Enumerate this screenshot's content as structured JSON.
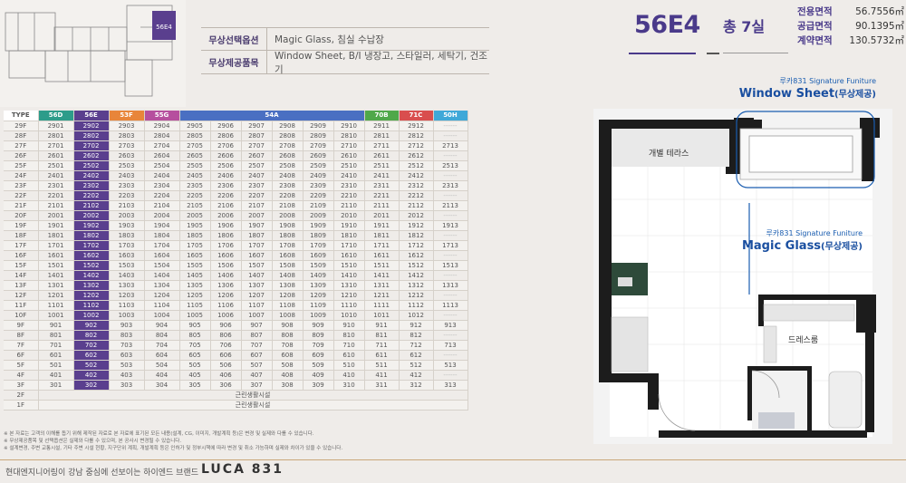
{
  "keyplan": {
    "highlight_label": "56E4"
  },
  "options": [
    {
      "label": "무상선택옵션",
      "value": "Magic Glass, 침실 수납장"
    },
    {
      "label": "무상제공품목",
      "value": "Window Sheet, B/I 냉장고, 스타일러, 세탁기, 건조기"
    }
  ],
  "unit": {
    "name": "56E4",
    "rooms": "총 7실",
    "areas": [
      {
        "label": "전용면적",
        "value": "56.7556㎡"
      },
      {
        "label": "공급면적",
        "value": "90.1395㎡"
      },
      {
        "label": "계약면적",
        "value": "130.5732㎡"
      }
    ]
  },
  "table": {
    "type_label": "TYPE",
    "headers": [
      {
        "label": "56D",
        "color": "#2d9c8a",
        "span": 1
      },
      {
        "label": "56E",
        "color": "#5a3f8e",
        "span": 1
      },
      {
        "label": "53F",
        "color": "#e8853a",
        "span": 1
      },
      {
        "label": "55G",
        "color": "#b64f9e",
        "span": 1
      },
      {
        "label": "54A",
        "color": "#4a6fc2",
        "span": 6
      },
      {
        "label": "70B",
        "color": "#4fa84a",
        "span": 1
      },
      {
        "label": "71C",
        "color": "#d94e4e",
        "span": 1
      },
      {
        "label": "50H",
        "color": "#3fa8d8",
        "span": 1
      }
    ],
    "highlight_col": 1,
    "rows": [
      {
        "floor": "29F",
        "cells": [
          "2901",
          "2902",
          "2903",
          "2904",
          "2905",
          "2906",
          "2907",
          "2908",
          "2909",
          "2910",
          "2911",
          "2912",
          ""
        ]
      },
      {
        "floor": "28F",
        "cells": [
          "2801",
          "2802",
          "2803",
          "2804",
          "2805",
          "2806",
          "2807",
          "2808",
          "2809",
          "2810",
          "2811",
          "2812",
          ""
        ]
      },
      {
        "floor": "27F",
        "cells": [
          "2701",
          "2702",
          "2703",
          "2704",
          "2705",
          "2706",
          "2707",
          "2708",
          "2709",
          "2710",
          "2711",
          "2712",
          "2713"
        ]
      },
      {
        "floor": "26F",
        "cells": [
          "2601",
          "2602",
          "2603",
          "2604",
          "2605",
          "2606",
          "2607",
          "2608",
          "2609",
          "2610",
          "2611",
          "2612",
          ""
        ]
      },
      {
        "floor": "25F",
        "cells": [
          "2501",
          "2502",
          "2503",
          "2504",
          "2505",
          "2506",
          "2507",
          "2508",
          "2509",
          "2510",
          "2511",
          "2512",
          "2513"
        ]
      },
      {
        "floor": "24F",
        "cells": [
          "2401",
          "2402",
          "2403",
          "2404",
          "2405",
          "2406",
          "2407",
          "2408",
          "2409",
          "2410",
          "2411",
          "2412",
          ""
        ]
      },
      {
        "floor": "23F",
        "cells": [
          "2301",
          "2302",
          "2303",
          "2304",
          "2305",
          "2306",
          "2307",
          "2308",
          "2309",
          "2310",
          "2311",
          "2312",
          "2313"
        ]
      },
      {
        "floor": "22F",
        "cells": [
          "2201",
          "2202",
          "2203",
          "2204",
          "2205",
          "2206",
          "2207",
          "2208",
          "2209",
          "2210",
          "2211",
          "2212",
          ""
        ]
      },
      {
        "floor": "21F",
        "cells": [
          "2101",
          "2102",
          "2103",
          "2104",
          "2105",
          "2106",
          "2107",
          "2108",
          "2109",
          "2110",
          "2111",
          "2112",
          "2113"
        ]
      },
      {
        "floor": "20F",
        "cells": [
          "2001",
          "2002",
          "2003",
          "2004",
          "2005",
          "2006",
          "2007",
          "2008",
          "2009",
          "2010",
          "2011",
          "2012",
          ""
        ]
      },
      {
        "floor": "19F",
        "cells": [
          "1901",
          "1902",
          "1903",
          "1904",
          "1905",
          "1906",
          "1907",
          "1908",
          "1909",
          "1910",
          "1911",
          "1912",
          "1913"
        ]
      },
      {
        "floor": "18F",
        "cells": [
          "1801",
          "1802",
          "1803",
          "1804",
          "1805",
          "1806",
          "1807",
          "1808",
          "1809",
          "1810",
          "1811",
          "1812",
          ""
        ]
      },
      {
        "floor": "17F",
        "cells": [
          "1701",
          "1702",
          "1703",
          "1704",
          "1705",
          "1706",
          "1707",
          "1708",
          "1709",
          "1710",
          "1711",
          "1712",
          "1713"
        ]
      },
      {
        "floor": "16F",
        "cells": [
          "1601",
          "1602",
          "1603",
          "1604",
          "1605",
          "1606",
          "1607",
          "1608",
          "1609",
          "1610",
          "1611",
          "1612",
          ""
        ]
      },
      {
        "floor": "15F",
        "cells": [
          "1501",
          "1502",
          "1503",
          "1504",
          "1505",
          "1506",
          "1507",
          "1508",
          "1509",
          "1510",
          "1511",
          "1512",
          "1513"
        ]
      },
      {
        "floor": "14F",
        "cells": [
          "1401",
          "1402",
          "1403",
          "1404",
          "1405",
          "1406",
          "1407",
          "1408",
          "1409",
          "1410",
          "1411",
          "1412",
          ""
        ]
      },
      {
        "floor": "13F",
        "cells": [
          "1301",
          "1302",
          "1303",
          "1304",
          "1305",
          "1306",
          "1307",
          "1308",
          "1309",
          "1310",
          "1311",
          "1312",
          "1313"
        ]
      },
      {
        "floor": "12F",
        "cells": [
          "1201",
          "1202",
          "1203",
          "1204",
          "1205",
          "1206",
          "1207",
          "1208",
          "1209",
          "1210",
          "1211",
          "1212",
          ""
        ]
      },
      {
        "floor": "11F",
        "cells": [
          "1101",
          "1102",
          "1103",
          "1104",
          "1105",
          "1106",
          "1107",
          "1108",
          "1109",
          "1110",
          "1111",
          "1112",
          "1113"
        ]
      },
      {
        "floor": "10F",
        "cells": [
          "1001",
          "1002",
          "1003",
          "1004",
          "1005",
          "1006",
          "1007",
          "1008",
          "1009",
          "1010",
          "1011",
          "1012",
          ""
        ]
      },
      {
        "floor": "9F",
        "cells": [
          "901",
          "902",
          "903",
          "904",
          "905",
          "906",
          "907",
          "908",
          "909",
          "910",
          "911",
          "912",
          "913"
        ]
      },
      {
        "floor": "8F",
        "cells": [
          "801",
          "802",
          "803",
          "804",
          "805",
          "806",
          "807",
          "808",
          "809",
          "810",
          "811",
          "812",
          ""
        ]
      },
      {
        "floor": "7F",
        "cells": [
          "701",
          "702",
          "703",
          "704",
          "705",
          "706",
          "707",
          "708",
          "709",
          "710",
          "711",
          "712",
          "713"
        ]
      },
      {
        "floor": "6F",
        "cells": [
          "601",
          "602",
          "603",
          "604",
          "605",
          "606",
          "607",
          "608",
          "609",
          "610",
          "611",
          "612",
          ""
        ]
      },
      {
        "floor": "5F",
        "cells": [
          "501",
          "502",
          "503",
          "504",
          "505",
          "506",
          "507",
          "508",
          "509",
          "510",
          "511",
          "512",
          "513"
        ]
      },
      {
        "floor": "4F",
        "cells": [
          "401",
          "402",
          "403",
          "404",
          "405",
          "406",
          "407",
          "408",
          "409",
          "410",
          "411",
          "412",
          ""
        ]
      },
      {
        "floor": "3F",
        "cells": [
          "301",
          "302",
          "303",
          "304",
          "305",
          "306",
          "307",
          "308",
          "309",
          "310",
          "311",
          "312",
          "313"
        ]
      }
    ],
    "special_rows": [
      {
        "floor": "2F",
        "text": "근린생활시설"
      },
      {
        "floor": "1F",
        "text": "근린생활시설"
      }
    ]
  },
  "notes": [
    "※ 본 자료는 고객의 이해를 돕기 위해 제작된 자료로 본 자료에 표기된 모든 내용(설계, CG, 이미지, 개발계획 등)은 변경 및 실제와 다를 수 있습니다.",
    "※ 무상제공품목 및 선택옵션은 실제와 다를 수 있으며, 본 공사시 변경될 수 있습니다.",
    "※ 설계변경, 주변 교통시설, 기타 주변 시설 현황, 지구단위 계획, 개발계획 등은 인허가 및 정부시책에 따라 변경 및 취소 가능하며 실제와 차이가 있을 수 있습니다."
  ],
  "footer": {
    "slogan": "현대엔지니어링이 강남 중심에 선보이는 하이엔드 브랜드",
    "brand": "LUCA 831"
  },
  "floorplan": {
    "callout_window": {
      "sub": "루카831 Signature Funiture",
      "main": "Window Sheet",
      "note": "(무상제공)"
    },
    "callout_glass": {
      "sub": "루카831 Signature Funiture",
      "main": "Magic Glass",
      "note": "(무상제공)"
    },
    "rooms": {
      "terrace": "개별 테라스",
      "dressroom": "드레스룸"
    },
    "highlight_color": "#1a5db0"
  }
}
